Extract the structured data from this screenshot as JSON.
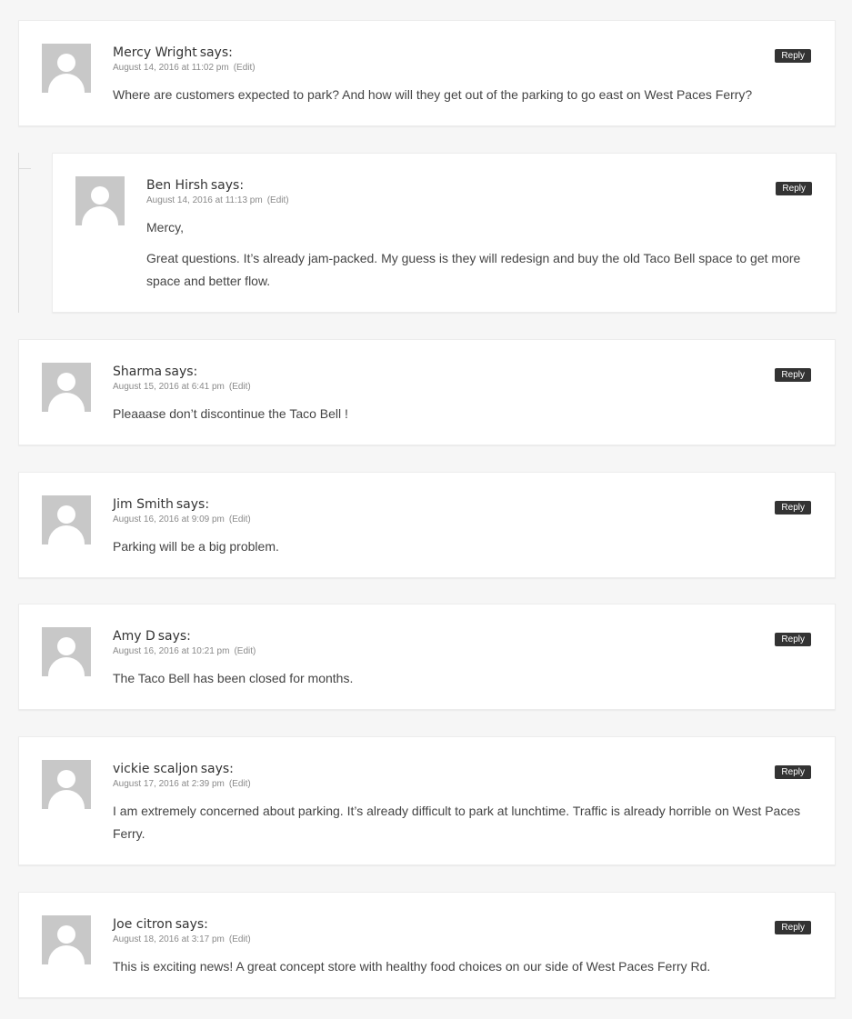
{
  "comments": [
    {
      "author": "Mercy Wright",
      "says": "says:",
      "date": "August 14, 2016 at 11:02 pm",
      "edit": "(Edit)",
      "reply": "Reply",
      "paragraphs": [
        "Where are customers expected to park? And how will they get out of the parking to go east on West Paces Ferry?"
      ]
    },
    {
      "author": "Ben Hirsh",
      "says": "says:",
      "date": "August 14, 2016 at 11:13 pm",
      "edit": "(Edit)",
      "reply": "Reply",
      "paragraphs": [
        "Mercy,",
        "Great questions. It’s already jam-packed. My guess is they will redesign and buy the old Taco Bell space to get more space and better flow."
      ]
    },
    {
      "author": "Sharma",
      "says": "says:",
      "date": "August 15, 2016 at 6:41 pm",
      "edit": "(Edit)",
      "reply": "Reply",
      "paragraphs": [
        "Pleaaase don’t discontinue the Taco Bell !"
      ]
    },
    {
      "author": "Jim Smith",
      "says": "says:",
      "date": "August 16, 2016 at 9:09 pm",
      "edit": "(Edit)",
      "reply": "Reply",
      "paragraphs": [
        "Parking will be a big problem."
      ]
    },
    {
      "author": "Amy D",
      "says": "says:",
      "date": "August 16, 2016 at 10:21 pm",
      "edit": "(Edit)",
      "reply": "Reply",
      "paragraphs": [
        "The Taco Bell has been closed for months."
      ]
    },
    {
      "author": "vickie scaljon",
      "says": "says:",
      "date": "August 17, 2016 at 2:39 pm",
      "edit": "(Edit)",
      "reply": "Reply",
      "paragraphs": [
        "I am extremely concerned about parking. It’s already difficult to park at lunchtime. Traffic is already horrible on West Paces Ferry."
      ]
    },
    {
      "author": "Joe citron",
      "says": "says:",
      "date": "August 18, 2016 at 3:17 pm",
      "edit": "(Edit)",
      "reply": "Reply",
      "paragraphs": [
        "This is exciting news! A great concept store with healthy food choices on our side of West Paces Ferry Rd."
      ]
    }
  ]
}
